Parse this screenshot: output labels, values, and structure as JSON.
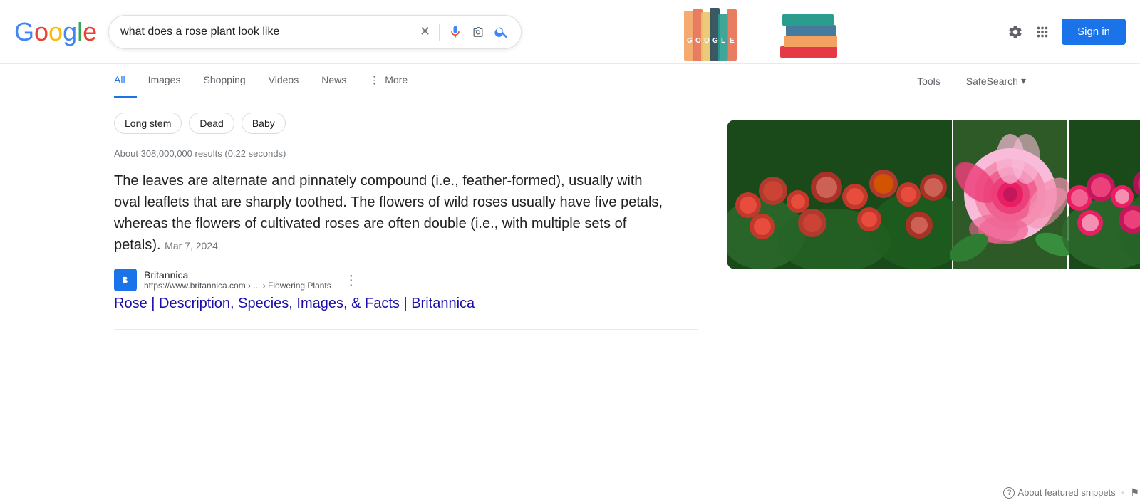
{
  "header": {
    "logo_text": "Google",
    "search_query": "what does a rose plant look like",
    "sign_in_label": "Sign in",
    "settings_tooltip": "Settings",
    "apps_tooltip": "Google apps"
  },
  "nav": {
    "tabs": [
      {
        "id": "all",
        "label": "All",
        "active": true
      },
      {
        "id": "images",
        "label": "Images",
        "active": false
      },
      {
        "id": "shopping",
        "label": "Shopping",
        "active": false
      },
      {
        "id": "videos",
        "label": "Videos",
        "active": false
      },
      {
        "id": "news",
        "label": "News",
        "active": false
      },
      {
        "id": "more",
        "label": "More",
        "active": false
      }
    ],
    "tools_label": "Tools",
    "safesearch_label": "SafeSearch"
  },
  "chips": [
    {
      "label": "Long stem"
    },
    {
      "label": "Dead"
    },
    {
      "label": "Baby"
    }
  ],
  "results": {
    "count_text": "About 308,000,000 results (0.22 seconds)",
    "snippet": {
      "text": "The leaves are alternate and pinnately compound (i.e., feather-formed), usually with oval leaflets that are sharply toothed. The flowers of wild roses usually have five petals, whereas the flowers of cultivated roses are often double (i.e., with multiple sets of petals).",
      "date": "Mar 7, 2024"
    },
    "source": {
      "name": "Britannica",
      "url": "https://www.britannica.com › ... › Flowering Plants",
      "breadcrumb": "Flowering Plants",
      "favicon_letter": "🌱"
    },
    "link": {
      "text": "Rose | Description, Species, Images, & Facts | Britannica",
      "href": "#"
    }
  },
  "bottom": {
    "about_snippets": "About featured snippets",
    "feedback": "Feedback",
    "dot_separator": "•"
  },
  "icons": {
    "close": "✕",
    "mic": "🎤",
    "camera": "📷",
    "search": "🔍",
    "settings": "⚙",
    "apps_grid": "⋮⋮⋮",
    "more_dots": "⋮",
    "chevron_down": "▾",
    "question_circle": "?",
    "flag": "⚑"
  }
}
